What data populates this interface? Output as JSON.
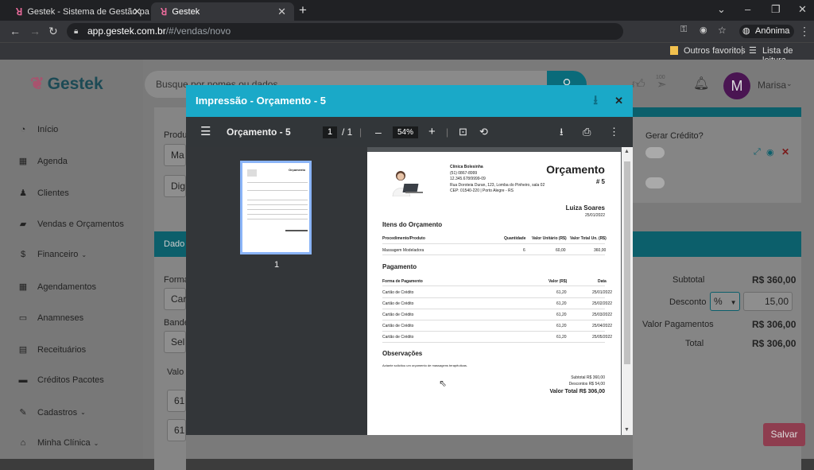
{
  "browser": {
    "tabs": [
      {
        "title": "Gestek - Sistema de Gestão para"
      },
      {
        "title": "Gestek"
      }
    ],
    "url_host": "app.gestek.com.br",
    "url_path": "/#/vendas/novo",
    "profile": "Anônima",
    "bookmarks": [
      "Outros favoritos",
      "Lista de leitura"
    ]
  },
  "app": {
    "logo": "Gestek",
    "search_placeholder": "Busque por nomes ou dados",
    "user_initial": "M",
    "user_name": "Marisa",
    "badge_count": "100",
    "sidebar": [
      {
        "label": "Início",
        "icon": "dashboard-icon"
      },
      {
        "label": "Agenda",
        "icon": "calendar-icon"
      },
      {
        "label": "Clientes",
        "icon": "users-icon"
      },
      {
        "label": "Vendas e Orçamentos",
        "icon": "bag-icon"
      },
      {
        "label": "Financeiro",
        "icon": "dollar-icon"
      },
      {
        "label": "Agendamentos",
        "icon": "calendar-icon"
      },
      {
        "label": "Anamneses",
        "icon": "id-card-icon"
      },
      {
        "label": "Receituários",
        "icon": "file-icon"
      },
      {
        "label": "Créditos Pacotes",
        "icon": "ticket-icon"
      },
      {
        "label": "Cadastros",
        "icon": "edit-icon"
      },
      {
        "label": "Minha Clínica",
        "icon": "home-icon"
      }
    ],
    "background": {
      "produto_label": "Produ",
      "field1": "Ma",
      "field2": "Dig",
      "gerar_credito": "Gerar Crédito?",
      "dados_head": "Dado",
      "forma_label": "Forma",
      "forma_field": "Car",
      "bandeira_label": "Bande",
      "bandeira_field": "Sel",
      "valor_label": "Valo",
      "row1": "61",
      "row2": "61",
      "subtotal_label": "Subtotal",
      "subtotal_value": "R$ 360,00",
      "desconto_label": "Desconto",
      "desconto_unit": "%",
      "desconto_value": "15,00",
      "valor_pag_label": "Valor Pagamentos",
      "valor_pag_value": "R$ 306,00",
      "total_label": "Total",
      "total_value": "R$ 306,00",
      "save_label": "Salvar"
    }
  },
  "modal": {
    "title": "Impressão - Orçamento - 5",
    "pdf": {
      "doc_title": "Orçamento - 5",
      "page_current": "1",
      "page_total": "/ 1",
      "zoom": "54%",
      "thumb_page_number": "1"
    },
    "document": {
      "clinic_name": "Clínica Bolesinha",
      "phone": "(51) 0867-8999",
      "cnpj": "12.345.678/9999-09",
      "address": "Rua Doroteia Duran, 123, Lomba do Pinheiro, sala 02",
      "cep": "CEP: 01540-220 | Porto Alegre - RS",
      "heading": "Orçamento",
      "number": "# 5",
      "client": "Luiza Soares",
      "date": "25/01/2022",
      "items_title": "Itens do Orçamento",
      "items_headers": [
        "Procedimento/Produto",
        "Quantidade",
        "Valor Unitário (R$)",
        "Valor Total Un. (R$)"
      ],
      "items": [
        {
          "name": "Massagem Modeladora",
          "qty": "6",
          "unit": "60,00",
          "total": "360,00"
        }
      ],
      "payment_title": "Pagamento",
      "payment_headers": [
        "Forma de Pagamento",
        "Valor (R$)",
        "Data"
      ],
      "payments": [
        {
          "method": "Cartão de Crédito",
          "value": "61,20",
          "date": "25/01/2022"
        },
        {
          "method": "Cartão de Crédito",
          "value": "61,20",
          "date": "25/02/2022"
        },
        {
          "method": "Cartão de Crédito",
          "value": "61,20",
          "date": "25/03/2022"
        },
        {
          "method": "Cartão de Crédito",
          "value": "61,20",
          "date": "25/04/2022"
        },
        {
          "method": "Cartão de Crédito",
          "value": "61,20",
          "date": "25/05/2022"
        }
      ],
      "obs_title": "Observações",
      "obs_text": "Actante solicitou um orçamento de massagens terapêuticas.",
      "subtotal": "Subtotal R$ 360,00",
      "discount": "Descontos R$ 54,00",
      "total": "Valor Total R$ 306,00"
    }
  }
}
